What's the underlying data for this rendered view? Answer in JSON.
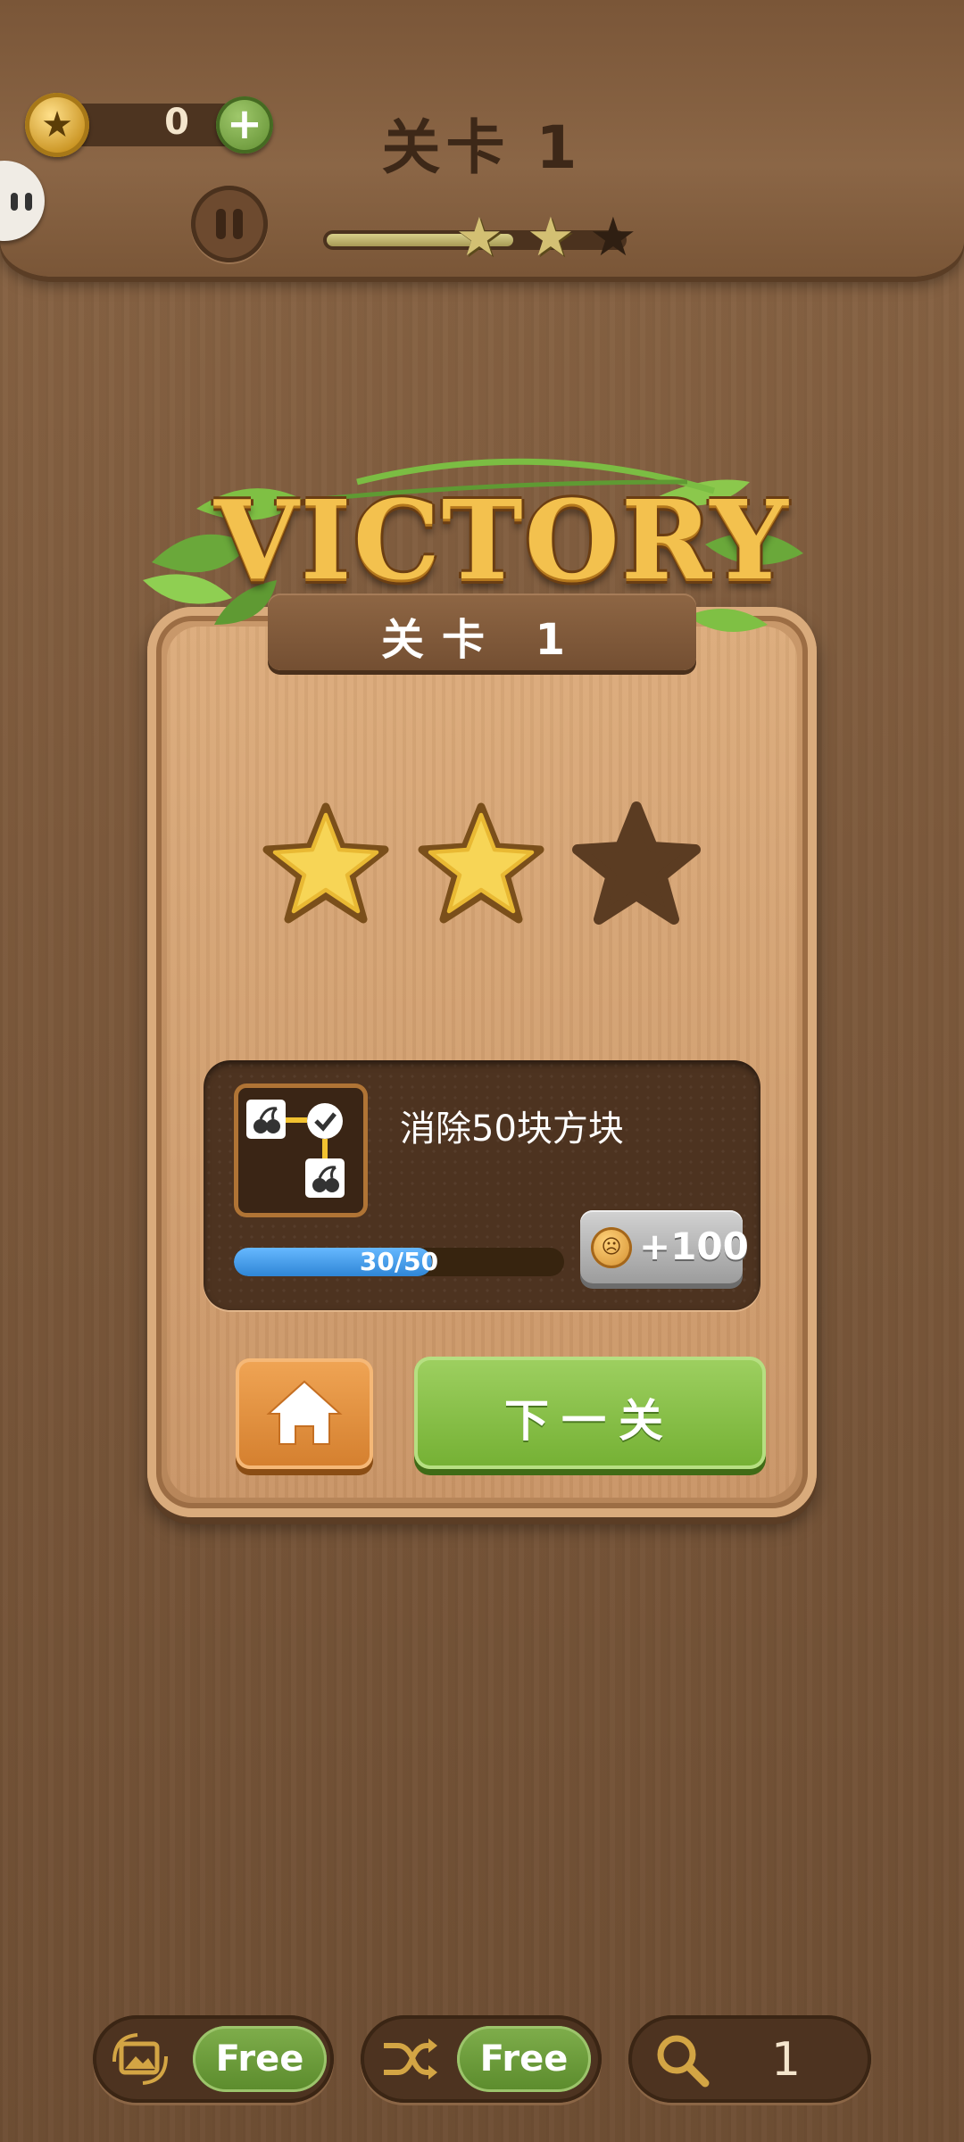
{
  "header": {
    "coins": "0",
    "level_title": "关卡 1",
    "progress_fraction": 0.63,
    "stars_earned": 2,
    "stars_total": 3
  },
  "result": {
    "banner": "VICTORY",
    "level_label": "关卡 1",
    "stars_earned": 2,
    "stars_total": 3
  },
  "task": {
    "description": "消除50块方块",
    "progress_text": "30/50",
    "progress_fraction": 0.6,
    "reward": "+100"
  },
  "buttons": {
    "next_label": "下一关"
  },
  "tools": [
    {
      "icon": "image-swap-icon",
      "badge": "Free"
    },
    {
      "icon": "shuffle-icon",
      "badge": "Free"
    },
    {
      "icon": "search-icon",
      "count": "1"
    }
  ],
  "colors": {
    "wood": "#7d5a3c",
    "gold": "#f3c14e",
    "green": "#74b033",
    "orange": "#d47f2e",
    "blue": "#2f86d6"
  }
}
